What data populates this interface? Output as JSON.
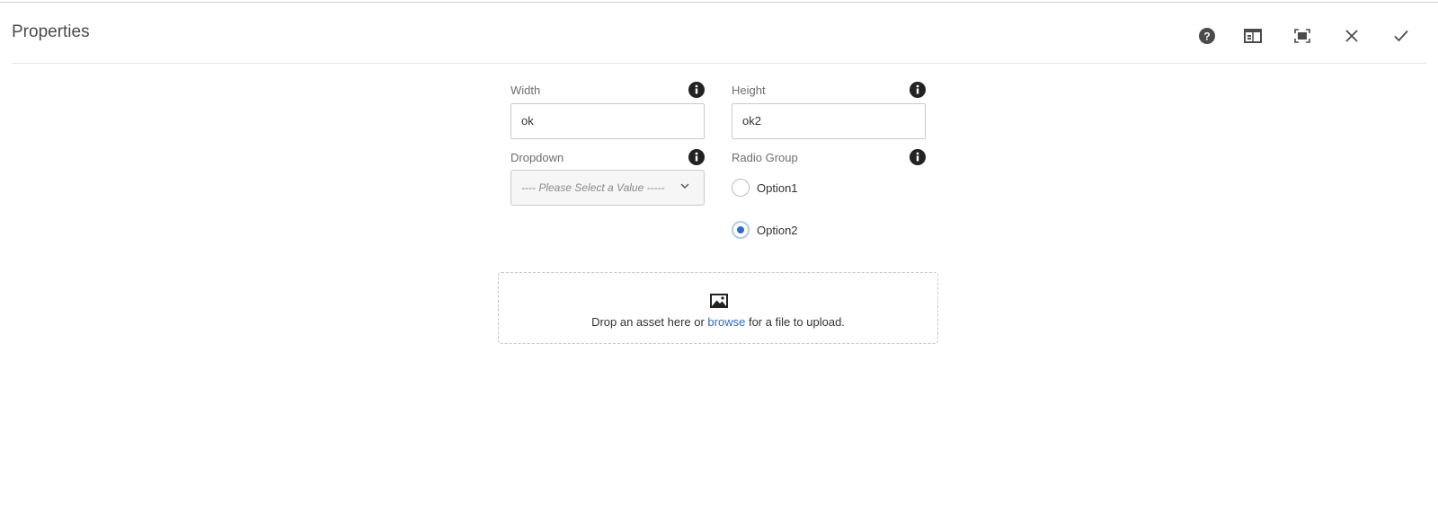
{
  "dialog": {
    "title": "Properties"
  },
  "header_actions": [
    {
      "name": "help-icon"
    },
    {
      "name": "toggle-side-panel-icon"
    },
    {
      "name": "fullscreen-icon"
    },
    {
      "name": "close-icon"
    },
    {
      "name": "checkmark-icon"
    }
  ],
  "form": {
    "width": {
      "label": "Width",
      "value": "ok"
    },
    "height": {
      "label": "Height",
      "value": "ok2"
    },
    "dropdown": {
      "label": "Dropdown",
      "placeholder": "---- Please Select a Value -----"
    },
    "radio_group": {
      "label": "Radio Group",
      "options": [
        {
          "label": "Option1",
          "checked": false
        },
        {
          "label": "Option2",
          "checked": true
        }
      ]
    }
  },
  "upload": {
    "text_before": "Drop an asset here or ",
    "link_text": "browse",
    "text_after": " for a file to upload."
  },
  "colors": {
    "accent": "#2f6bc4",
    "icon": "#4b4b4b",
    "border": "#cacaca"
  }
}
